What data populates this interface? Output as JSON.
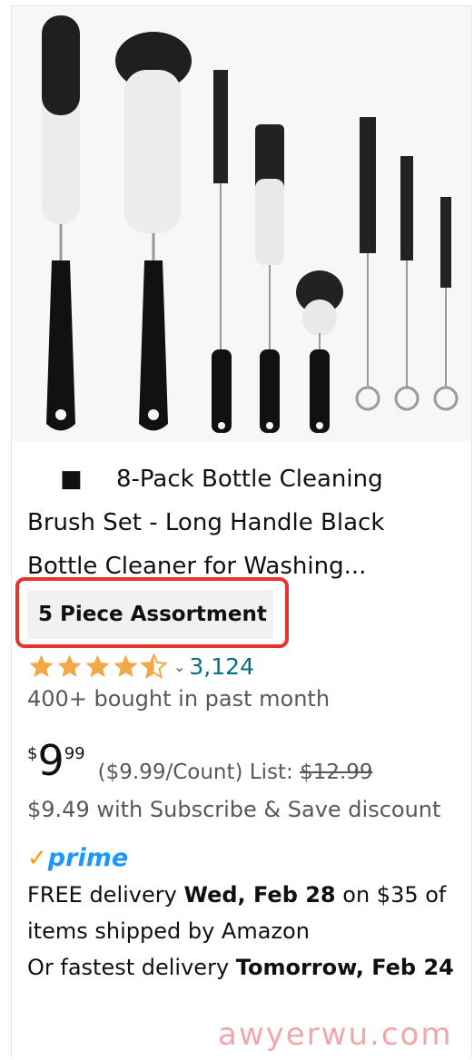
{
  "product": {
    "bullet": "■",
    "title": "8-Pack Bottle Cleaning Brush Set - Long Handle Black Bottle Cleaner for Washing...",
    "title_line1": "8-Pack Bottle Cleaning",
    "title_line2": "Brush Set - Long Handle Black",
    "title_line3": "Bottle Cleaner for Washing...",
    "variant": "5 Piece Assortment"
  },
  "rating": {
    "stars": 4.5,
    "chevron": "⌄",
    "review_count": "3,124"
  },
  "social_proof": "400+ bought in past month",
  "price": {
    "symbol": "$",
    "whole": "9",
    "fraction": "99",
    "unit_price": "($9.99/Count)",
    "list_label": "List:",
    "list_price": "$12.99"
  },
  "subscribe_save": "$9.49 with Subscribe & Save discount",
  "prime": {
    "check": "✓",
    "label": "prime"
  },
  "delivery": {
    "free_prefix": "FREE delivery",
    "free_date": "Wed, Feb 28",
    "free_suffix": "on $35 of items shipped by Amazon",
    "fast_prefix": "Or fastest delivery",
    "fast_date": "Tomorrow, Feb 24"
  },
  "watermark": "awyerwu.com",
  "colors": {
    "star": "#f3a847",
    "link": "#007185",
    "prime": "#1a98ff",
    "highlight": "#e8322c"
  }
}
